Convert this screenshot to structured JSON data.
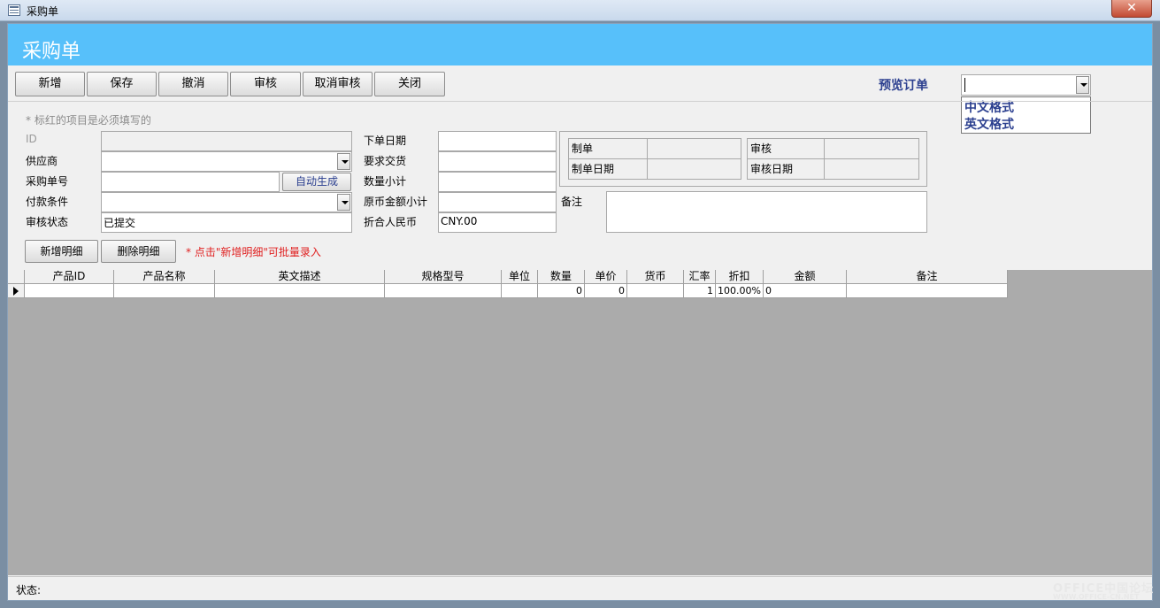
{
  "window": {
    "title": "采购单",
    "close_label": "✕"
  },
  "header": {
    "title": "采购单"
  },
  "toolbar": {
    "buttons": [
      "新增",
      "保存",
      "撤消",
      "审核",
      "取消审核",
      "关闭"
    ],
    "preview_label": "预览订单",
    "preview_value": "",
    "preview_options": [
      "中文格式",
      "英文格式"
    ]
  },
  "form": {
    "required_note": "* 标红的项目是必须填写的",
    "id_label": "ID",
    "supplier_label": "供应商",
    "po_number_label": "采购单号",
    "auto_generate_label": "自动生成",
    "payment_terms_label": "付款条件",
    "audit_status_label": "审核状态",
    "audit_status_value": "已提交",
    "order_date_label": "下单日期",
    "required_delivery_label": "要求交货",
    "qty_subtotal_label": "数量小计",
    "orig_amount_label": "原币金额小计",
    "rmb_label": "折合人民币",
    "rmb_value": "CNY.00",
    "creator_label": "制单",
    "create_date_label": "制单日期",
    "auditor_label": "审核",
    "audit_date_label": "审核日期",
    "remarks_label": "备注",
    "add_detail_label": "新增明细",
    "delete_detail_label": "删除明细",
    "detail_hint": "* 点击\"新增明细\"可批量录入"
  },
  "grid": {
    "columns": [
      "产品ID",
      "产品名称",
      "英文描述",
      "规格型号",
      "单位",
      "数量",
      "单价",
      "货币",
      "汇率",
      "折扣",
      "金额",
      "备注"
    ],
    "rows": [
      [
        "",
        "",
        "",
        "",
        "",
        "0",
        "0",
        "",
        "1",
        "100.00%",
        "0",
        ""
      ]
    ]
  },
  "status": {
    "label": "状态:"
  },
  "watermark": {
    "text": "OFFICE中国论坛",
    "sub": "WWW.OFFICE-CN.NET"
  }
}
